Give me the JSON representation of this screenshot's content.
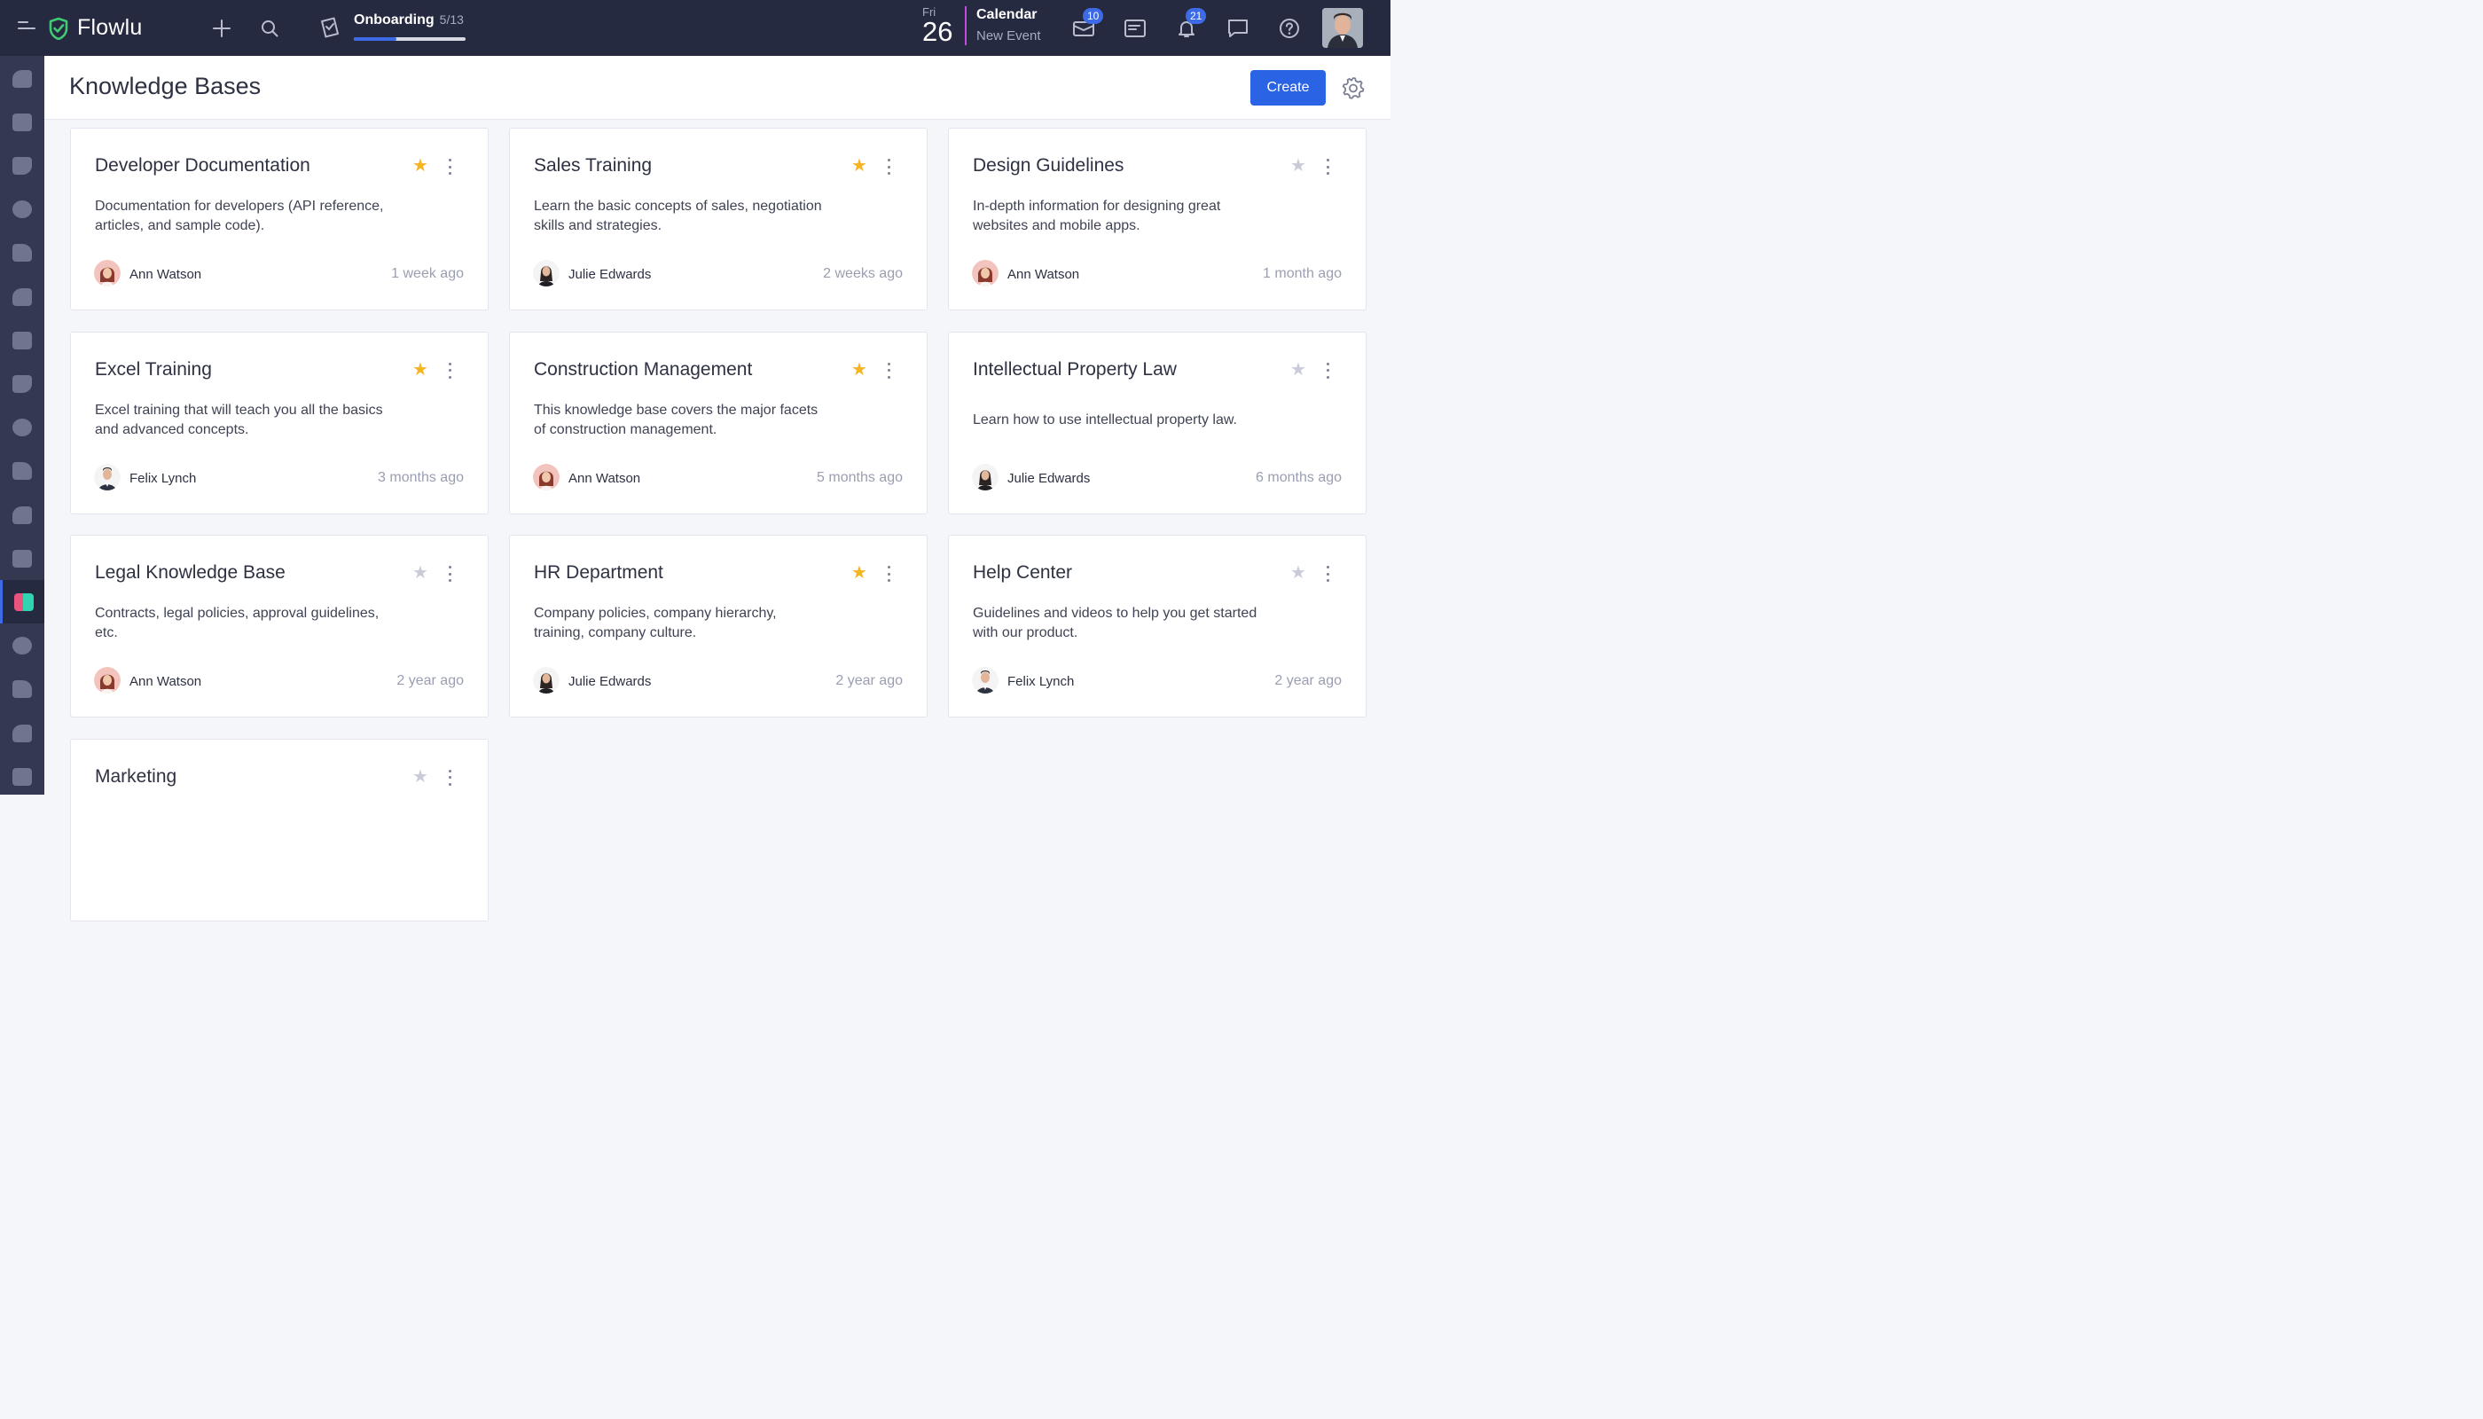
{
  "app": {
    "name": "Flowlu"
  },
  "topbar": {
    "onboarding": {
      "label": "Onboarding",
      "count": "5/13",
      "progress": 0.38
    },
    "date": {
      "weekday": "Fri",
      "day": "26"
    },
    "calendar": {
      "title": "Calendar",
      "subtitle": "New Event"
    },
    "mail_badge": "10",
    "notifications_badge": "21",
    "icons": [
      "menu-icon",
      "plus-icon",
      "search-icon",
      "onboarding-icon",
      "mail-icon",
      "notes-icon",
      "bell-icon",
      "chat-icon",
      "help-icon"
    ]
  },
  "sidebar": {
    "items": [
      "crm",
      "projects",
      "sales",
      "finance",
      "team",
      "integrations",
      "feedback",
      "documents",
      "contacts",
      "files",
      "workflows",
      "apps",
      "knowledge-base",
      "education",
      "dashboard",
      "reports",
      "settings"
    ],
    "active_index": 12
  },
  "header": {
    "title": "Knowledge Bases",
    "create_label": "Create"
  },
  "colors": {
    "accent": "#2b63e5",
    "star_active": "#f5b422",
    "star_inactive": "#c9ccd8"
  },
  "cards": [
    {
      "title": "Developer Documentation",
      "description": "Documentation for developers (API reference, articles, and sample code).",
      "author": "Ann Watson",
      "avatar": "ann",
      "time": "1 week ago",
      "starred": true
    },
    {
      "title": "Sales Training",
      "description": "Learn the basic concepts of sales, negotiation skills and strategies.",
      "author": "Julie Edwards",
      "avatar": "julie",
      "time": "2 weeks ago",
      "starred": true
    },
    {
      "title": "Design Guidelines",
      "description": "In-depth information for designing great websites and mobile apps.",
      "author": "Ann Watson",
      "avatar": "ann",
      "time": "1 month ago",
      "starred": false
    },
    {
      "title": "Excel Training",
      "description": "Excel training that will teach you all the basics and advanced concepts.",
      "author": "Felix Lynch",
      "avatar": "felix",
      "time": "3 months ago",
      "starred": true
    },
    {
      "title": "Construction Management",
      "description": "This knowledge base covers the major facets of construction management.",
      "author": "Ann Watson",
      "avatar": "ann",
      "time": "5 months ago",
      "starred": true
    },
    {
      "title": "Intellectual Property Law",
      "description": "Learn how to use intellectual property law.",
      "author": "Julie Edwards",
      "avatar": "julie",
      "time": "6 months ago",
      "starred": false
    },
    {
      "title": "Legal Knowledge Base",
      "description": "Contracts, legal policies, approval guidelines, etc.",
      "author": "Ann Watson",
      "avatar": "ann",
      "time": "2 year ago",
      "starred": false
    },
    {
      "title": "HR Department",
      "description": "Company policies, company hierarchy, training, company culture.",
      "author": "Julie Edwards",
      "avatar": "julie",
      "time": "2 year ago",
      "starred": true
    },
    {
      "title": "Help Center",
      "description": "Guidelines and videos to help you get started with our product.",
      "author": "Felix Lynch",
      "avatar": "felix",
      "time": "2 year ago",
      "starred": false
    },
    {
      "title": "Marketing",
      "description": "",
      "author": "",
      "avatar": "",
      "time": "",
      "starred": false
    }
  ]
}
